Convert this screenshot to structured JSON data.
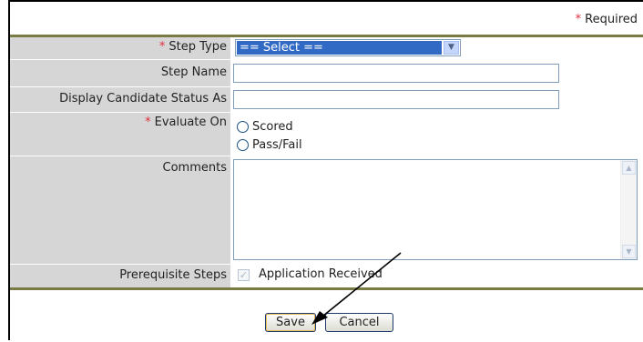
{
  "required_note": {
    "star": "*",
    "text": "Required"
  },
  "form": {
    "step_type": {
      "star": "*",
      "label": "Step Type",
      "selected": "== Select =="
    },
    "step_name": {
      "label": "Step Name",
      "value": ""
    },
    "display_status": {
      "label": "Display Candidate Status As",
      "value": ""
    },
    "evaluate_on": {
      "star": "*",
      "label": "Evaluate On",
      "options": [
        "Scored",
        "Pass/Fail"
      ]
    },
    "comments": {
      "label": "Comments",
      "value": ""
    },
    "prerequisite": {
      "label": "Prerequisite Steps",
      "item": "Application Received",
      "checked": true
    }
  },
  "buttons": {
    "save": "Save",
    "cancel": "Cancel"
  },
  "icons": {
    "dropdown": "chevron-down-icon",
    "check": "checkmark-icon",
    "annotation": "arrow-pointer"
  }
}
